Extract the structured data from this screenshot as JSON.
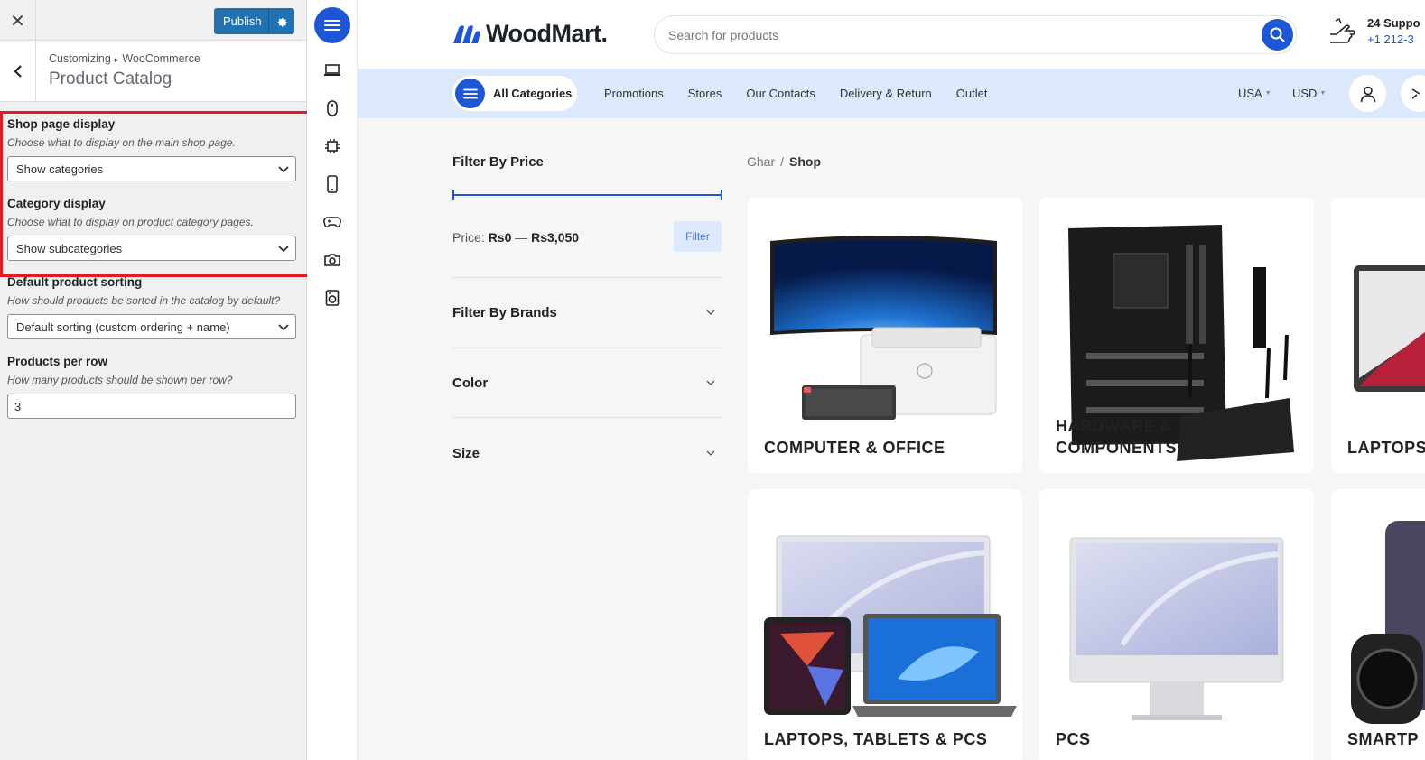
{
  "customizer": {
    "close_icon": "✕",
    "publish_label": "Publish",
    "breadcrumb_root": "Customizing",
    "breadcrumb_parent": "WooCommerce",
    "title": "Product Catalog",
    "controls": {
      "shop_display": {
        "title": "Shop page display",
        "description": "Choose what to display on the main shop page.",
        "value": "Show categories"
      },
      "category_display": {
        "title": "Category display",
        "description": "Choose what to display on product category pages.",
        "value": "Show subcategories"
      },
      "sorting": {
        "title": "Default product sorting",
        "description": "How should products be sorted in the catalog by default?",
        "value": "Default sorting (custom ordering + name)"
      },
      "per_row": {
        "title": "Products per row",
        "description": "How many products should be shown per row?",
        "value": "3"
      }
    }
  },
  "site": {
    "logo_text": "WoodMart.",
    "search_placeholder": "Search for products",
    "support_title": "24 Suppo",
    "support_phone": "+1 212-3",
    "all_categories": "All Categories",
    "nav_links": [
      "Promotions",
      "Stores",
      "Our Contacts",
      "Delivery & Return",
      "Outlet"
    ],
    "country": "USA",
    "currency": "USD",
    "filter_price_title": "Filter By Price",
    "price_label": "Price:",
    "price_min": "Rs0",
    "price_dash": "—",
    "price_max": "Rs3,050",
    "filter_button": "Filter",
    "filter_brands": "Filter By Brands",
    "filter_color": "Color",
    "filter_size": "Size",
    "breadcrumb_home": "Ghar",
    "breadcrumb_sep": "/",
    "breadcrumb_current": "Shop",
    "categories": [
      {
        "name": "COMPUTER & OFFICE"
      },
      {
        "name": "HARDWARE & COMPONENTS"
      },
      {
        "name": "LAPTOPS"
      },
      {
        "name": "LAPTOPS, TABLETS & PCS"
      },
      {
        "name": "PCS"
      },
      {
        "name": "SMARTP"
      }
    ]
  },
  "colors": {
    "accent": "#1d57d8",
    "wp_blue": "#2271b1",
    "highlight": "#e21c24",
    "nav_bg": "#dce8fb"
  }
}
